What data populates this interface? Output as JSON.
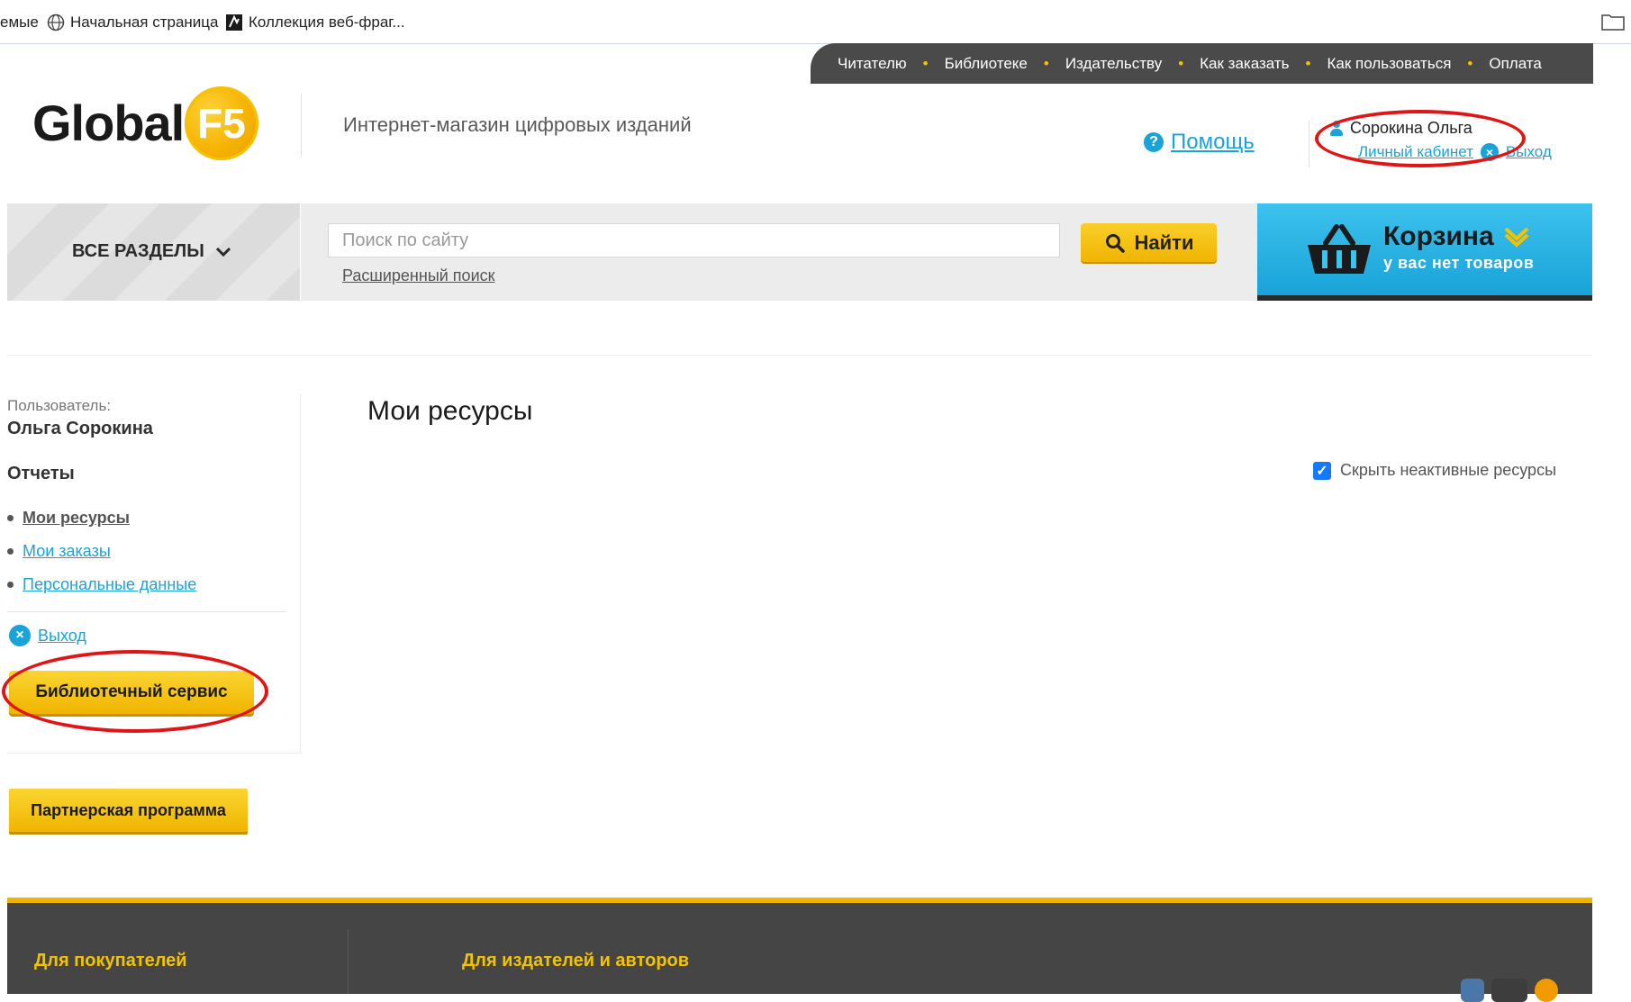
{
  "favorites_bar": {
    "items": [
      {
        "label": "емые"
      },
      {
        "label": "Начальная страница",
        "icon": "globe-icon"
      },
      {
        "label": "Коллекция веб-фраг...",
        "icon": "webslice-icon"
      }
    ]
  },
  "top_nav": {
    "items": [
      "Читателю",
      "Библиотеке",
      "Издательству",
      "Как заказать",
      "Как пользоваться",
      "Оплата"
    ]
  },
  "header": {
    "logo_text": "Global",
    "logo_badge": "F5",
    "tagline": "Интернет-магазин цифровых изданий",
    "help_label": "Помощь",
    "user_name": "Сорокина Ольга",
    "cabinet_link": "Личный кабинет",
    "logout_link": "Выход"
  },
  "search": {
    "all_sections": "ВСЕ РАЗДЕЛЫ",
    "placeholder": "Поиск по сайту",
    "button": "Найти",
    "advanced": "Расширенный поиск"
  },
  "cart": {
    "title": "Корзина",
    "subtitle": "у вас нет товаров"
  },
  "sidebar": {
    "user_label": "Пользователь:",
    "user_name": "Ольга Сорокина",
    "reports_title": "Отчеты",
    "links": [
      {
        "label": "Мои ресурсы",
        "active": true
      },
      {
        "label": "Мои заказы",
        "active": false
      },
      {
        "label": "Персональные данные",
        "active": false
      }
    ],
    "exit": "Выход",
    "library_service_btn": "Библиотечный сервис",
    "partner_btn": "Партнерская программа"
  },
  "main": {
    "title": "Мои ресурсы",
    "hide_inactive": "Скрыть неактивные ресурсы",
    "hide_inactive_checked": true
  },
  "footer": {
    "col1_title": "Для покупателей",
    "col2_title": "Для издателей и авторов"
  },
  "colors": {
    "accent_yellow": "#f0b400",
    "link_blue": "#1aa3d8",
    "dark_nav": "#4a4a4a",
    "highlight_red": "#e01616"
  }
}
